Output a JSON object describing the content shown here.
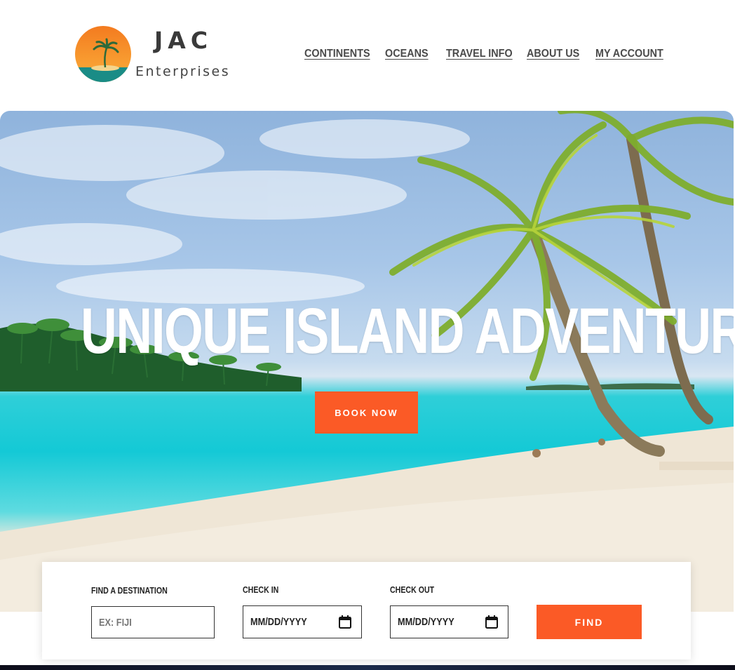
{
  "brand": {
    "name": "JAC",
    "tagline": "Enterprises",
    "logo_icon": "sunset-palm-logo"
  },
  "nav": {
    "items": [
      {
        "label": "CONTINENTS"
      },
      {
        "label": "OCEANS"
      },
      {
        "label": "TRAVEL INFO"
      },
      {
        "label": "ABOUT US"
      },
      {
        "label": "MY ACCOUNT"
      }
    ]
  },
  "hero": {
    "title": "UNIQUE ISLAND ADVENTURES",
    "button_label": "BOOK NOW"
  },
  "search": {
    "destination": {
      "label": "FIND A DESTINATION",
      "placeholder": "EX: FIJI"
    },
    "check_in": {
      "label": "CHECK IN",
      "value": "MM/DD/YYYY",
      "icon": "calendar-icon"
    },
    "check_out": {
      "label": "CHECK OUT",
      "value": "MM/DD/YYYY",
      "icon": "calendar-icon"
    },
    "find_label": "FIND"
  },
  "colors": {
    "accent": "#fb5a26",
    "nav_text": "#4a4a4a",
    "logo_orange": "#f7941d",
    "logo_teal": "#1a8c86"
  }
}
